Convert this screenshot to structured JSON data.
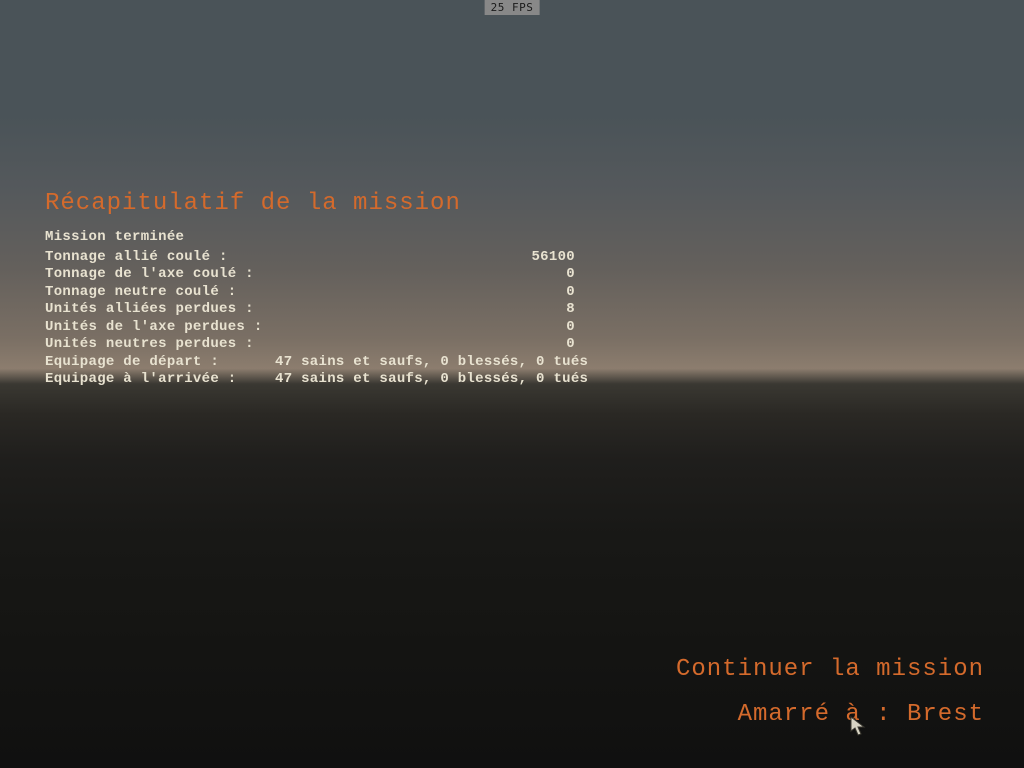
{
  "fps": "25 FPS",
  "panel": {
    "title": "Récapitulatif de la mission",
    "status": "Mission terminée",
    "stats": [
      {
        "label": "Tonnage allié coulé :",
        "value": "56100"
      },
      {
        "label": "Tonnage de l'axe coulé :",
        "value": "0"
      },
      {
        "label": "Tonnage neutre coulé :",
        "value": "0"
      },
      {
        "label": "Unités alliées perdues :",
        "value": "8"
      },
      {
        "label": "Unités de l'axe perdues :",
        "value": "0"
      },
      {
        "label": "Unités neutres perdues :",
        "value": "0"
      }
    ],
    "crew": [
      {
        "label": "Equipage de départ :",
        "value": "47 sains et saufs,  0 blessés,  0 tués"
      },
      {
        "label": "Equipage à l'arrivée :",
        "value": "47 sains et saufs,  0 blessés,  0 tués"
      }
    ]
  },
  "actions": {
    "continue": "Continuer la mission",
    "dock": "Amarré à : Brest"
  }
}
